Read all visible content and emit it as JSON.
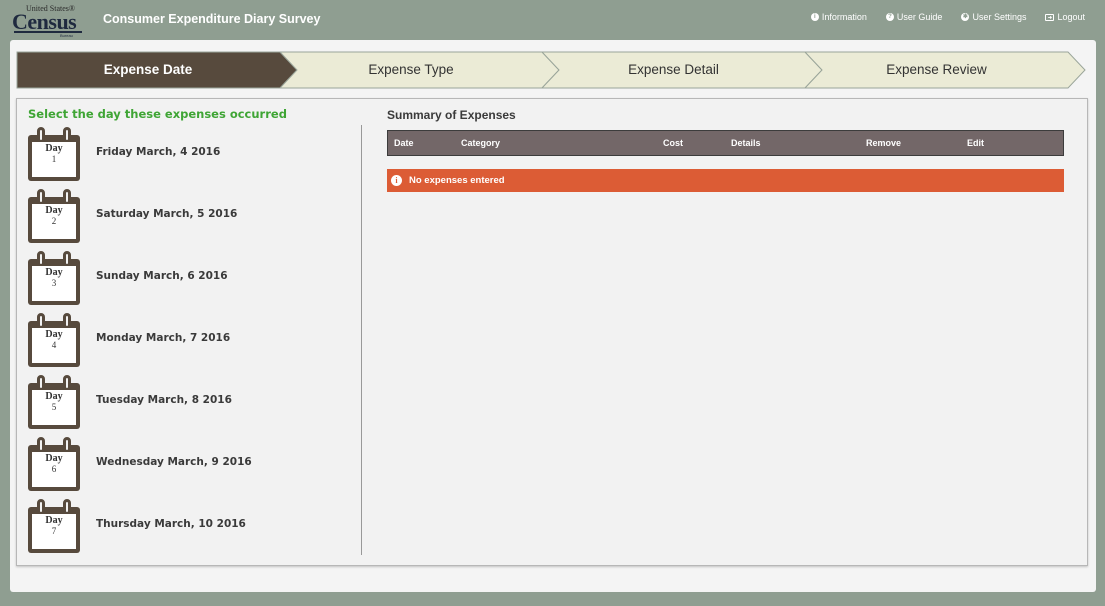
{
  "header": {
    "logo": {
      "small_text": "United States®",
      "main_text": "Census",
      "bureau_text": "Bureau"
    },
    "app_title": "Consumer Expenditure Diary Survey",
    "nav": [
      {
        "label": "Information",
        "icon": "info-icon"
      },
      {
        "label": "User Guide",
        "icon": "question-icon"
      },
      {
        "label": "User Settings",
        "icon": "gear-icon"
      },
      {
        "label": "Logout",
        "icon": "logout-icon"
      }
    ]
  },
  "wizard": {
    "steps": [
      {
        "label": "Expense Date",
        "active": true
      },
      {
        "label": "Expense Type",
        "active": false
      },
      {
        "label": "Expense Detail",
        "active": false
      },
      {
        "label": "Expense Review",
        "active": false
      }
    ],
    "colors": {
      "active": "#574a3d",
      "inactive": "#ebebd6",
      "border": "#9aa59a"
    }
  },
  "days": {
    "heading": "Select the day these expenses occurred",
    "calendar_word": "Day",
    "items": [
      {
        "num": "1",
        "label": "Friday March, 4 2016"
      },
      {
        "num": "2",
        "label": "Saturday March, 5 2016"
      },
      {
        "num": "3",
        "label": "Sunday March, 6 2016"
      },
      {
        "num": "4",
        "label": "Monday March, 7 2016"
      },
      {
        "num": "5",
        "label": "Tuesday March, 8 2016"
      },
      {
        "num": "6",
        "label": "Wednesday March, 9 2016"
      },
      {
        "num": "7",
        "label": "Thursday March, 10 2016"
      }
    ]
  },
  "summary": {
    "title": "Summary of Expenses",
    "columns": [
      "Date",
      "Category",
      "Cost",
      "Details",
      "Remove",
      "Edit"
    ],
    "empty_message": "No expenses entered",
    "alert_color": "#dc5c35"
  }
}
